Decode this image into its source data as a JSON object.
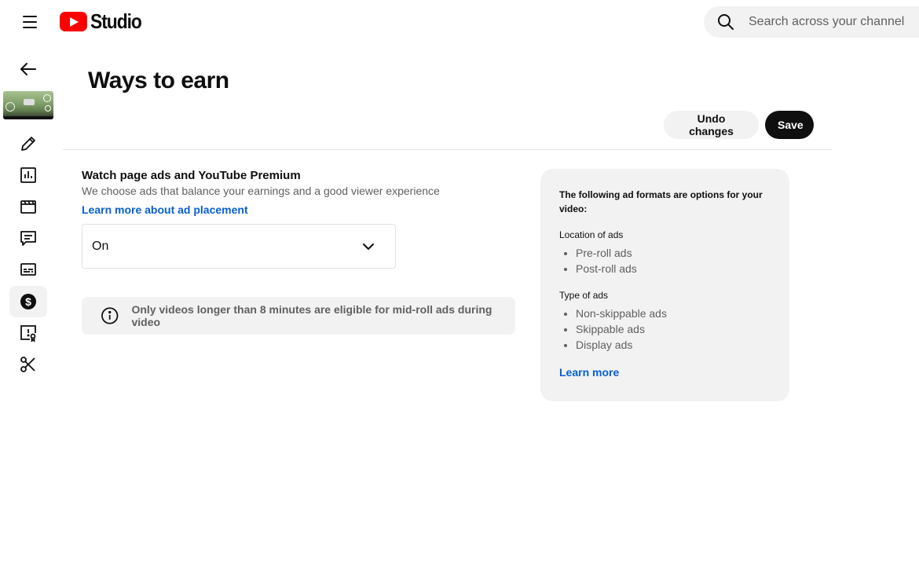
{
  "header": {
    "logo_text": "Studio",
    "search_placeholder": "Search across your channel"
  },
  "sidebar": {
    "items": [
      {
        "name": "back",
        "icon": "arrow-left-icon"
      },
      {
        "name": "video-thumbnail"
      },
      {
        "name": "details",
        "icon": "pencil-icon"
      },
      {
        "name": "analytics",
        "icon": "bar-chart-icon"
      },
      {
        "name": "editor",
        "icon": "clapperboard-icon"
      },
      {
        "name": "comments",
        "icon": "comment-icon"
      },
      {
        "name": "subtitles",
        "icon": "subtitles-icon"
      },
      {
        "name": "monetization",
        "icon": "dollar-icon",
        "active": true
      },
      {
        "name": "copyright",
        "icon": "copyright-claim-icon"
      },
      {
        "name": "clips",
        "icon": "scissors-icon"
      }
    ]
  },
  "main": {
    "title": "Ways to earn",
    "undo_label": "Undo changes",
    "save_label": "Save",
    "section": {
      "title": "Watch page ads and YouTube Premium",
      "description": "We choose ads that balance your earnings and a good viewer experience",
      "link": "Learn more about ad placement",
      "select_value": "On"
    },
    "notice": "Only videos longer than 8 minutes are eligible for mid-roll ads during video"
  },
  "info_card": {
    "intro": "The following ad formats are options for your video:",
    "location_label": "Location of ads",
    "location_items": [
      "Pre-roll ads",
      "Post-roll ads"
    ],
    "type_label": "Type of ads",
    "type_items": [
      "Non-skippable ads",
      "Skippable ads",
      "Display ads"
    ],
    "learn_more": "Learn more"
  },
  "colors": {
    "brand_red": "#ff0000",
    "link_blue": "#065fd4",
    "surface": "#f2f2f2",
    "text_secondary": "#606060"
  }
}
